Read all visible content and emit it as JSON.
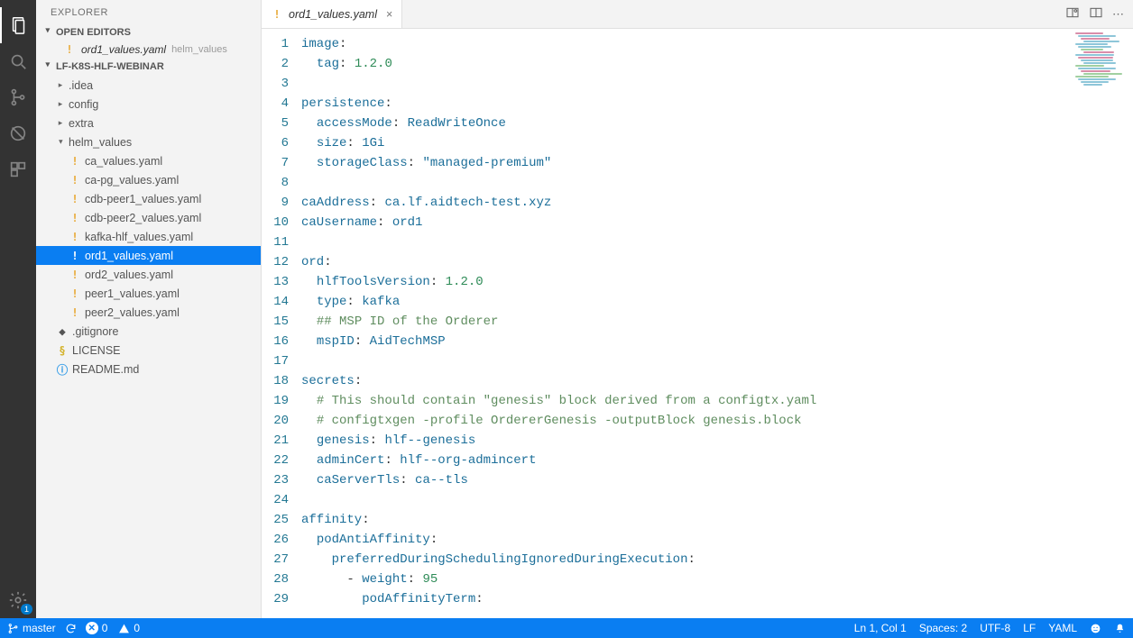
{
  "sidebar": {
    "title": "EXPLORER",
    "sections": {
      "open_editors": {
        "label": "OPEN EDITORS",
        "items": [
          {
            "icon": "!",
            "name": "ord1_values.yaml",
            "path": "helm_values"
          }
        ]
      },
      "project": {
        "label": "LF-K8S-HLF-WEBINAR",
        "tree": [
          {
            "type": "folder",
            "name": ".idea",
            "depth": 0,
            "expanded": false
          },
          {
            "type": "folder",
            "name": "config",
            "depth": 0,
            "expanded": false
          },
          {
            "type": "folder",
            "name": "extra",
            "depth": 0,
            "expanded": false
          },
          {
            "type": "folder",
            "name": "helm_values",
            "depth": 0,
            "expanded": true
          },
          {
            "type": "file",
            "name": "ca_values.yaml",
            "icon": "yaml",
            "depth": 1
          },
          {
            "type": "file",
            "name": "ca-pg_values.yaml",
            "icon": "yaml",
            "depth": 1
          },
          {
            "type": "file",
            "name": "cdb-peer1_values.yaml",
            "icon": "yaml",
            "depth": 1
          },
          {
            "type": "file",
            "name": "cdb-peer2_values.yaml",
            "icon": "yaml",
            "depth": 1
          },
          {
            "type": "file",
            "name": "kafka-hlf_values.yaml",
            "icon": "yaml",
            "depth": 1
          },
          {
            "type": "file",
            "name": "ord1_values.yaml",
            "icon": "yaml",
            "depth": 1,
            "selected": true
          },
          {
            "type": "file",
            "name": "ord2_values.yaml",
            "icon": "yaml",
            "depth": 1
          },
          {
            "type": "file",
            "name": "peer1_values.yaml",
            "icon": "yaml",
            "depth": 1
          },
          {
            "type": "file",
            "name": "peer2_values.yaml",
            "icon": "yaml",
            "depth": 1
          },
          {
            "type": "file",
            "name": ".gitignore",
            "icon": "git",
            "depth": 0
          },
          {
            "type": "file",
            "name": "LICENSE",
            "icon": "lic",
            "depth": 0
          },
          {
            "type": "file",
            "name": "README.md",
            "icon": "md",
            "depth": 0
          }
        ]
      }
    }
  },
  "editor": {
    "tab": {
      "icon": "!",
      "name": "ord1_values.yaml"
    },
    "lines": [
      [
        [
          "key",
          "image"
        ],
        [
          "colon",
          ":"
        ]
      ],
      [
        [
          "plain",
          "  "
        ],
        [
          "key",
          "tag"
        ],
        [
          "colon",
          ": "
        ],
        [
          "num",
          "1.2.0"
        ]
      ],
      [],
      [
        [
          "key",
          "persistence"
        ],
        [
          "colon",
          ":"
        ]
      ],
      [
        [
          "plain",
          "  "
        ],
        [
          "key",
          "accessMode"
        ],
        [
          "colon",
          ": "
        ],
        [
          "val",
          "ReadWriteOnce"
        ]
      ],
      [
        [
          "plain",
          "  "
        ],
        [
          "key",
          "size"
        ],
        [
          "colon",
          ": "
        ],
        [
          "val",
          "1Gi"
        ]
      ],
      [
        [
          "plain",
          "  "
        ],
        [
          "key",
          "storageClass"
        ],
        [
          "colon",
          ": "
        ],
        [
          "str",
          "\"managed-premium\""
        ]
      ],
      [],
      [
        [
          "key",
          "caAddress"
        ],
        [
          "colon",
          ": "
        ],
        [
          "val",
          "ca.lf.aidtech-test.xyz"
        ]
      ],
      [
        [
          "key",
          "caUsername"
        ],
        [
          "colon",
          ": "
        ],
        [
          "val",
          "ord1"
        ]
      ],
      [],
      [
        [
          "key",
          "ord"
        ],
        [
          "colon",
          ":"
        ]
      ],
      [
        [
          "plain",
          "  "
        ],
        [
          "key",
          "hlfToolsVersion"
        ],
        [
          "colon",
          ": "
        ],
        [
          "num",
          "1.2.0"
        ]
      ],
      [
        [
          "plain",
          "  "
        ],
        [
          "key",
          "type"
        ],
        [
          "colon",
          ": "
        ],
        [
          "val",
          "kafka"
        ]
      ],
      [
        [
          "plain",
          "  "
        ],
        [
          "comment",
          "## MSP ID of the Orderer"
        ]
      ],
      [
        [
          "plain",
          "  "
        ],
        [
          "key",
          "mspID"
        ],
        [
          "colon",
          ": "
        ],
        [
          "val",
          "AidTechMSP"
        ]
      ],
      [],
      [
        [
          "key",
          "secrets"
        ],
        [
          "colon",
          ":"
        ]
      ],
      [
        [
          "plain",
          "  "
        ],
        [
          "comment",
          "# This should contain \"genesis\" block derived from a configtx.yaml"
        ]
      ],
      [
        [
          "plain",
          "  "
        ],
        [
          "comment",
          "# configtxgen -profile OrdererGenesis -outputBlock genesis.block"
        ]
      ],
      [
        [
          "plain",
          "  "
        ],
        [
          "key",
          "genesis"
        ],
        [
          "colon",
          ": "
        ],
        [
          "val",
          "hlf--genesis"
        ]
      ],
      [
        [
          "plain",
          "  "
        ],
        [
          "key",
          "adminCert"
        ],
        [
          "colon",
          ": "
        ],
        [
          "val",
          "hlf--org-admincert"
        ]
      ],
      [
        [
          "plain",
          "  "
        ],
        [
          "key",
          "caServerTls"
        ],
        [
          "colon",
          ": "
        ],
        [
          "val",
          "ca--tls"
        ]
      ],
      [],
      [
        [
          "key",
          "affinity"
        ],
        [
          "colon",
          ":"
        ]
      ],
      [
        [
          "plain",
          "  "
        ],
        [
          "key",
          "podAntiAffinity"
        ],
        [
          "colon",
          ":"
        ]
      ],
      [
        [
          "plain",
          "    "
        ],
        [
          "key",
          "preferredDuringSchedulingIgnoredDuringExecution"
        ],
        [
          "colon",
          ":"
        ]
      ],
      [
        [
          "plain",
          "      - "
        ],
        [
          "key",
          "weight"
        ],
        [
          "colon",
          ": "
        ],
        [
          "num",
          "95"
        ]
      ],
      [
        [
          "plain",
          "        "
        ],
        [
          "key",
          "podAffinityTerm"
        ],
        [
          "colon",
          ":"
        ]
      ]
    ]
  },
  "statusbar": {
    "branch": "master",
    "errors": "0",
    "warnings": "0",
    "cursor": "Ln 1, Col 1",
    "spaces": "Spaces: 2",
    "encoding": "UTF-8",
    "eol": "LF",
    "lang": "YAML"
  },
  "activity_badge": "1"
}
